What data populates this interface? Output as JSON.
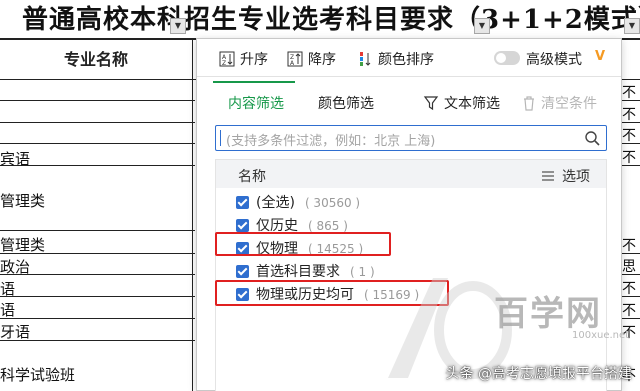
{
  "sheet": {
    "title": "普通高校本科招生专业选考科目要求（3+1+2模式）",
    "header": "专业名称",
    "rows": [
      "",
      "",
      "",
      "宾语",
      "",
      "管理类",
      "",
      "管理类",
      "政治",
      "语",
      "语",
      "牙语",
      "",
      "科学试验班"
    ],
    "right_col": [
      "不",
      "不",
      "不",
      "不",
      "",
      "",
      "",
      "不",
      "思",
      "不",
      "不",
      "不",
      "",
      "不"
    ]
  },
  "toolbar": {
    "sort_asc": "升序",
    "sort_desc": "降序",
    "color_sort": "颜色排序",
    "advanced_mode": "高级模式",
    "crown": "V"
  },
  "tabs": {
    "content_filter": "内容筛选",
    "color_filter": "颜色筛选",
    "text_filter": "文本筛选",
    "clear_conditions": "清空条件"
  },
  "search": {
    "placeholder": "(支持多条件过滤，例如：北京 上海)"
  },
  "list": {
    "name_header": "名称",
    "options_label": "选项",
    "items": [
      {
        "label": "(全选)",
        "count": "( 30560 )",
        "checked": true
      },
      {
        "label": "仅历史",
        "count": "( 865 )",
        "checked": true
      },
      {
        "label": "仅物理",
        "count": "( 14525 )",
        "checked": true
      },
      {
        "label": "首选科目要求",
        "count": "( 1 )",
        "checked": true
      },
      {
        "label": "物理或历史均可",
        "count": "( 15169 )",
        "checked": true
      }
    ]
  },
  "watermark": {
    "brand": "百学网",
    "sub": "100xue.net",
    "credit": "头条 @高考志愿填报平台搭建"
  },
  "colors": {
    "accent_green": "#17984a",
    "accent_blue": "#2f6ecf",
    "highlight_red": "#e02020",
    "crown_orange": "#f59a23"
  }
}
